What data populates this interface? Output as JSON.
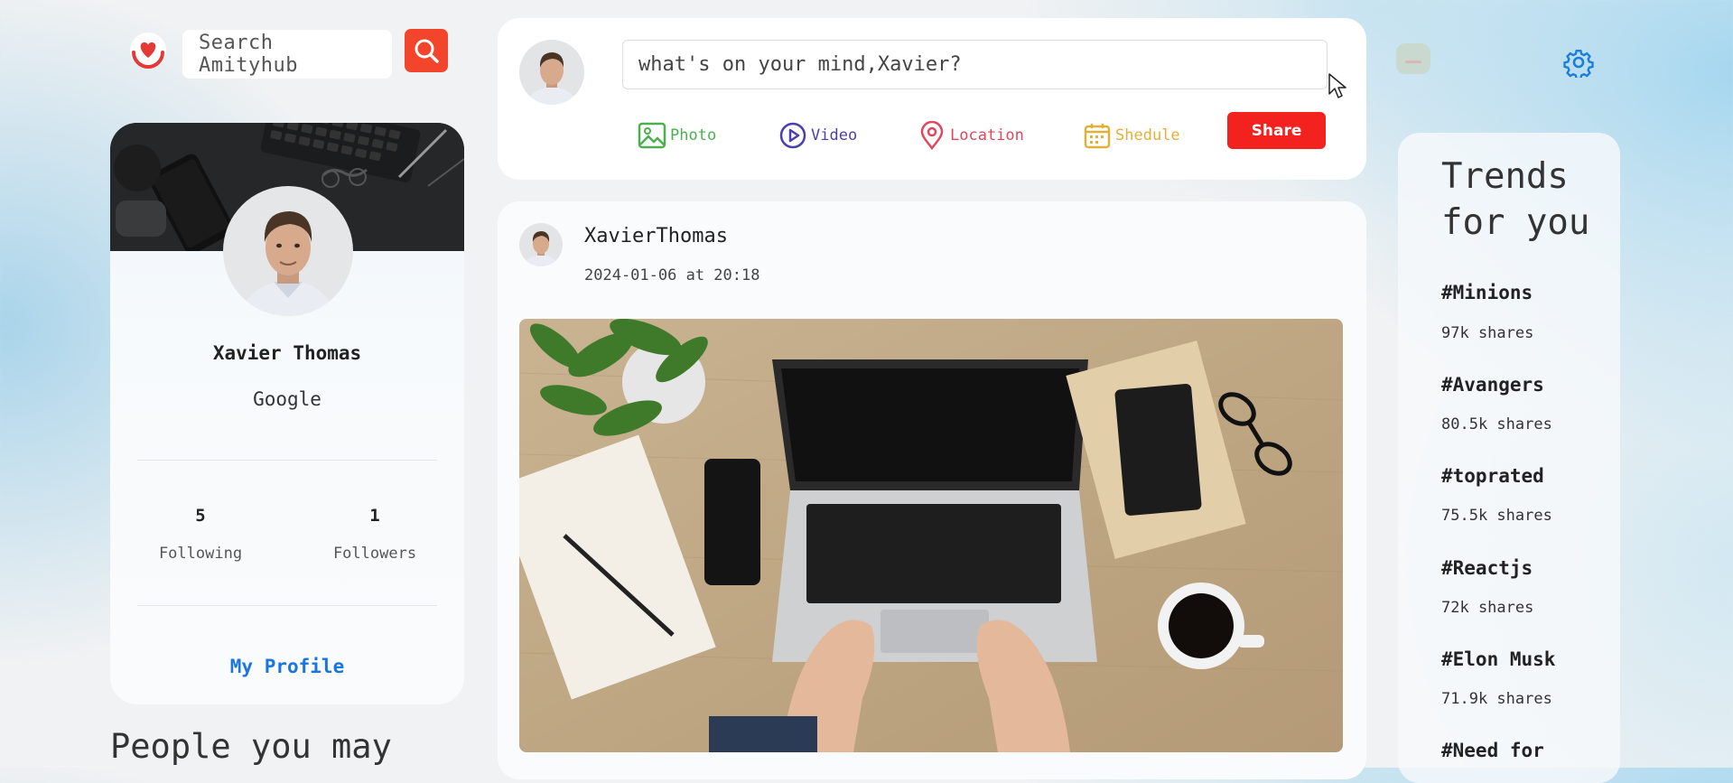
{
  "search": {
    "placeholder": "Search Amityhub"
  },
  "profile": {
    "name": "Xavier Thomas",
    "company": "Google",
    "following_count": "5",
    "following_label": "Following",
    "followers_count": "1",
    "followers_label": "Followers",
    "my_profile_label": "My Profile"
  },
  "people_you_may_know": {
    "title": "People you may"
  },
  "composer": {
    "placeholder": "what's on your mind,Xavier?",
    "options": [
      {
        "label": "Photo",
        "color": "#4caf50",
        "icon": "photo-icon"
      },
      {
        "label": "Video",
        "color": "#4a3fb0",
        "icon": "video-icon"
      },
      {
        "label": "Location",
        "color": "#e0475e",
        "icon": "location-icon"
      },
      {
        "label": "Shedule",
        "color": "#e2b03a",
        "icon": "calendar-icon"
      }
    ],
    "share_label": "Share"
  },
  "post": {
    "author": "XavierThomas",
    "date": "2024-01-06 at 20:18"
  },
  "trends": {
    "title": "Trends for you",
    "items": [
      {
        "tag": "#Minions",
        "shares": "97k shares"
      },
      {
        "tag": "#Avangers",
        "shares": "80.5k shares"
      },
      {
        "tag": "#toprated",
        "shares": "75.5k shares"
      },
      {
        "tag": "#Reactjs",
        "shares": "72k shares"
      },
      {
        "tag": "#Elon Musk",
        "shares": "71.9k shares"
      },
      {
        "tag": "#Need for",
        "shares": ""
      }
    ]
  },
  "colors": {
    "accent": "#f2452c",
    "share": "#f3221f",
    "link": "#1976e0",
    "gear": "#1c7ed6"
  }
}
